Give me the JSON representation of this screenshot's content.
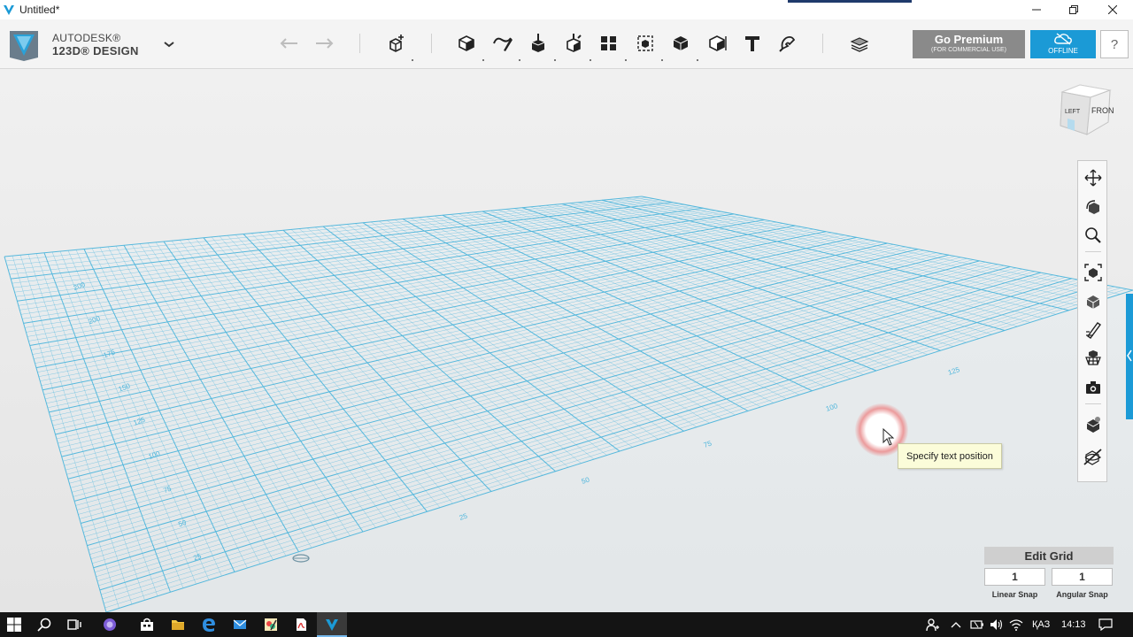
{
  "window": {
    "title": "Untitled*",
    "controls": [
      "minimize",
      "restore",
      "close"
    ]
  },
  "brand": {
    "line1": "AUTODESK®",
    "line2": "123D® DESIGN"
  },
  "toolbar": {
    "tools": [
      "undo-icon",
      "redo-icon",
      "transform-icon",
      "primitives-icon",
      "sketch-icon",
      "construct-icon",
      "modify-icon",
      "pattern-icon",
      "grouping-icon",
      "combine-icon",
      "measure-icon",
      "text-icon",
      "snap-icon",
      "material-icon"
    ],
    "premium_label": "Go Premium",
    "premium_sub": "(FOR COMMERCIAL USE)",
    "offline_label": "OFFLINE",
    "help_label": "?"
  },
  "viewcube": {
    "left": "LEFT",
    "front": "FRONT"
  },
  "navbar": {
    "tools": [
      "pan-icon",
      "orbit-icon",
      "zoom-icon",
      "fit-icon",
      "views-icon",
      "sketch-visibility-icon",
      "grid-visibility-icon",
      "screenshot-icon",
      "material-view-icon",
      "hide-icon"
    ]
  },
  "grid": {
    "left_labels": [
      "200",
      "200",
      "175",
      "150",
      "125",
      "100",
      "75",
      "50",
      "25"
    ],
    "front_labels": [
      "25",
      "50",
      "75",
      "100",
      "125"
    ],
    "color": "#4fb6dc"
  },
  "tooltip": {
    "text": "Specify text position"
  },
  "edit_grid": {
    "title": "Edit Grid",
    "linear_snap_value": "1",
    "angular_snap_value": "1",
    "linear_snap_label": "Linear Snap",
    "angular_snap_label": "Angular Snap"
  },
  "taskbar": {
    "apps": [
      "start-icon",
      "search-icon",
      "task-view-icon",
      "assistant-icon",
      "store-icon",
      "explorer-icon",
      "edge-icon",
      "mail-icon",
      "paint-icon",
      "pdf-icon",
      "123d-icon"
    ],
    "language": "ҚАЗ",
    "time": "14:13"
  },
  "colors": {
    "accent": "#1b9ad6",
    "premium": "#8a8a8a",
    "tooltip_bg": "#fbfcd9"
  }
}
